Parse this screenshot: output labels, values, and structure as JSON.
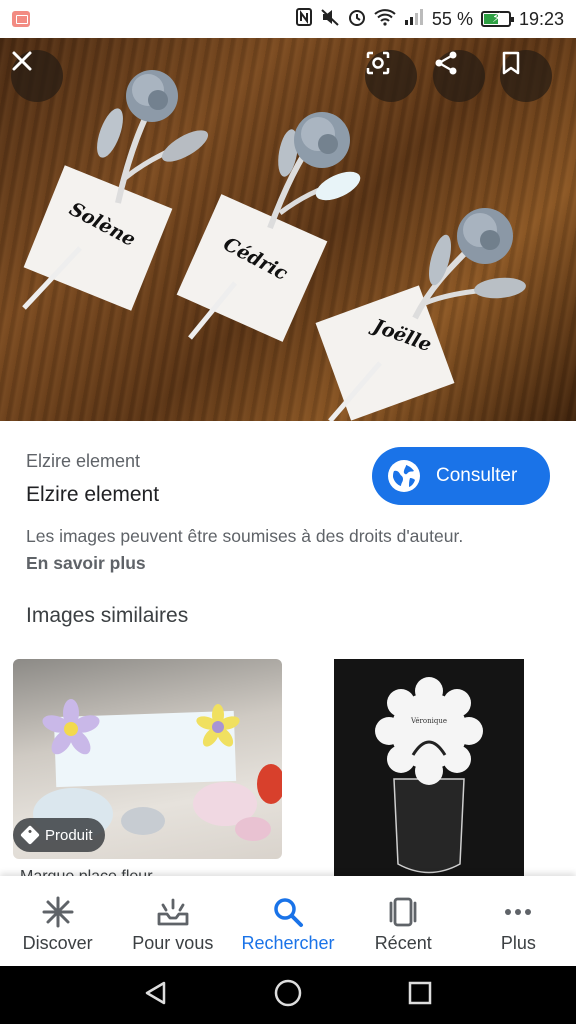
{
  "status_bar": {
    "battery_percent": "55 %",
    "time": "19:23",
    "battery_level": 0.55,
    "icons": [
      "notification-icon",
      "nfc-icon",
      "mute-icon",
      "alarm-icon",
      "wifi-icon",
      "signal-icon",
      "battery-icon"
    ]
  },
  "hero": {
    "image_labels": [
      "Solène",
      "Cédric",
      "Joëlle"
    ],
    "actions": [
      "close-icon",
      "lens-icon",
      "share-icon",
      "bookmark-icon"
    ]
  },
  "result": {
    "source_small": "Elzire element",
    "source_title": "Elzire element",
    "consult_label": "Consulter",
    "copyright_notice": "Les images peuvent être soumises à des droits d'auteur.",
    "learn_more": "En savoir plus"
  },
  "similar": {
    "heading": "Images similaires",
    "items": [
      {
        "badge": "Produit",
        "caption": "Marque place fleur"
      },
      {
        "card_text": "Véronique"
      }
    ]
  },
  "bottom_nav": {
    "items": [
      {
        "label": "Discover",
        "icon": "asterisk-icon"
      },
      {
        "label": "Pour vous",
        "icon": "inbox-icon"
      },
      {
        "label": "Rechercher",
        "icon": "search-icon"
      },
      {
        "label": "Récent",
        "icon": "recent-icon"
      },
      {
        "label": "Plus",
        "icon": "more-icon"
      }
    ],
    "active": "Rechercher"
  },
  "system_nav": [
    "back-icon",
    "home-icon",
    "overview-icon"
  ],
  "colors": {
    "accent": "#1a73e8",
    "nav_active": "#1a73e8"
  }
}
